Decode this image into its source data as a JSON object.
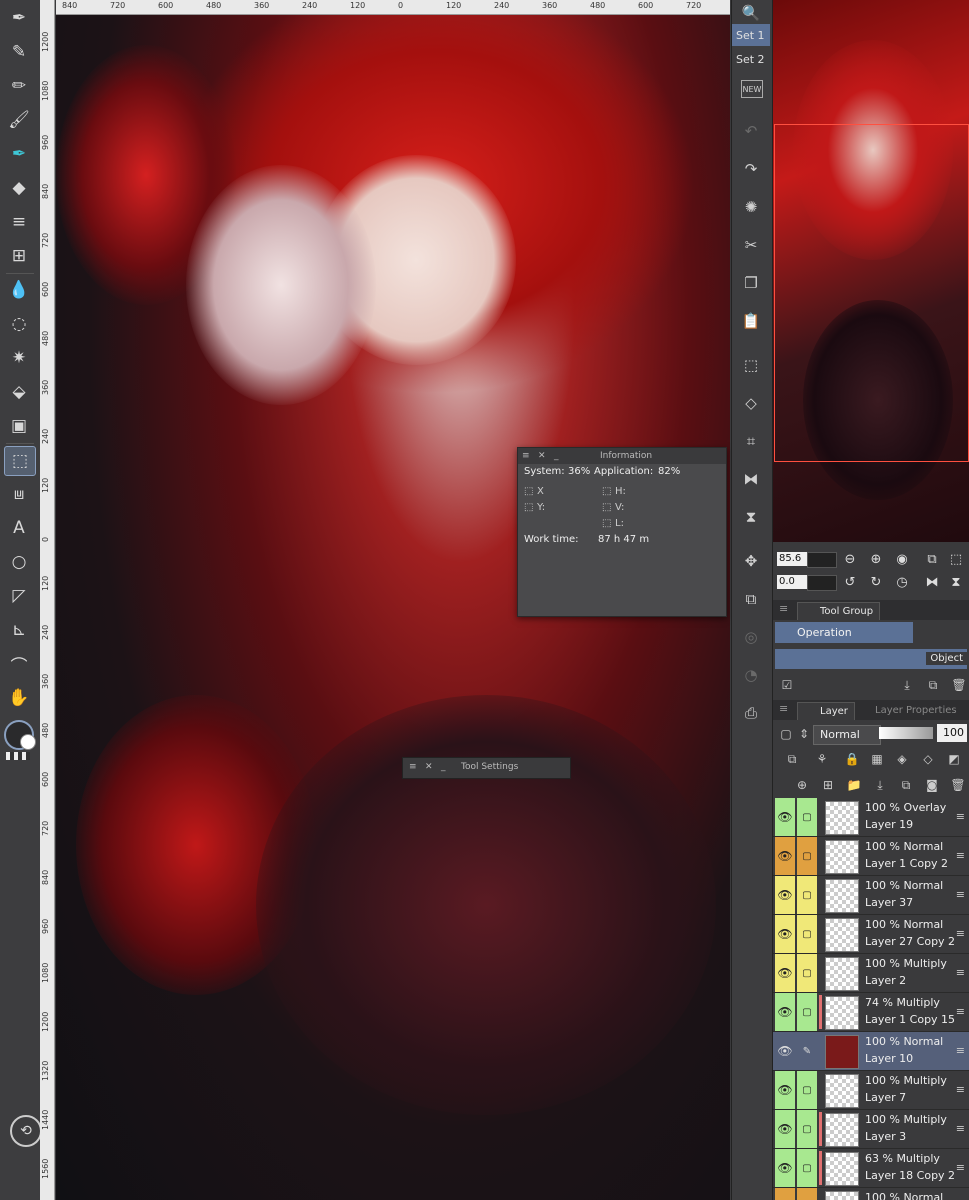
{
  "left_tools": [
    {
      "name": "fill-pen-icon",
      "glyph": "✒"
    },
    {
      "name": "pen-icon",
      "glyph": "✎"
    },
    {
      "name": "pencil-icon",
      "glyph": "✏"
    },
    {
      "name": "brush-icon",
      "glyph": "🖌"
    },
    {
      "name": "airbrush-icon",
      "glyph": "✒"
    },
    {
      "name": "eraser-icon",
      "glyph": "◆"
    },
    {
      "name": "hatching-icon",
      "glyph": "≡"
    },
    {
      "name": "grid-icon",
      "glyph": "⊞"
    },
    {
      "name": "blend-icon",
      "glyph": "💧"
    },
    {
      "name": "lasso-icon",
      "glyph": "◌"
    },
    {
      "name": "magic-wand-icon",
      "glyph": "✷"
    },
    {
      "name": "fill-icon",
      "glyph": "⬙"
    },
    {
      "name": "gradient-icon",
      "glyph": "▣"
    },
    {
      "name": "operation-icon",
      "glyph": "⬚"
    },
    {
      "name": "vector-icon",
      "glyph": "⩏"
    },
    {
      "name": "text-icon",
      "glyph": "A"
    },
    {
      "name": "balloon-icon",
      "glyph": "○"
    },
    {
      "name": "frame-icon",
      "glyph": "◸"
    },
    {
      "name": "ruler-icon",
      "glyph": "⊾"
    },
    {
      "name": "eyedropper-icon",
      "glyph": "⌒"
    },
    {
      "name": "hand-icon",
      "glyph": "✋"
    }
  ],
  "ruler_top": [
    "840",
    "720",
    "600",
    "480",
    "360",
    "240",
    "120",
    "0",
    "120",
    "240",
    "360",
    "480",
    "600",
    "720"
  ],
  "ruler_left": [
    "1200",
    "1080",
    "960",
    "840",
    "720",
    "600",
    "480",
    "360",
    "240",
    "120",
    "0",
    "120",
    "240",
    "360",
    "480",
    "600",
    "720",
    "840",
    "960",
    "1080",
    "1200",
    "1320",
    "1440",
    "1560"
  ],
  "sets": {
    "set1": "Set 1",
    "set2": "Set 2"
  },
  "mid_tools": [
    {
      "name": "new-icon",
      "glyph": "NEW",
      "dim": false
    },
    {
      "name": "undo-icon",
      "glyph": "↶",
      "dim": true
    },
    {
      "name": "redo-icon",
      "glyph": "↷",
      "dim": false
    },
    {
      "name": "loading-icon",
      "glyph": "✺",
      "dim": false
    },
    {
      "name": "cut-icon",
      "glyph": "✂",
      "dim": false
    },
    {
      "name": "copy-icon",
      "glyph": "❐",
      "dim": false
    },
    {
      "name": "paste-icon",
      "glyph": "📋",
      "dim": true
    },
    {
      "name": "transform-icon",
      "glyph": "⬚",
      "dim": false
    },
    {
      "name": "free-transform-icon",
      "glyph": "◇",
      "dim": false
    },
    {
      "name": "mesh-transform-icon",
      "glyph": "⌗",
      "dim": false
    },
    {
      "name": "flip-horizontal-icon",
      "glyph": "⧓",
      "dim": false
    },
    {
      "name": "flip-vertical-icon",
      "glyph": "⧗",
      "dim": false
    },
    {
      "name": "move-icon",
      "glyph": "✥",
      "dim": false
    },
    {
      "name": "snap-icon",
      "glyph": "⧉",
      "dim": false
    },
    {
      "name": "record-icon",
      "glyph": "◎",
      "dim": true
    },
    {
      "name": "timelapse-icon",
      "glyph": "◔",
      "dim": true
    },
    {
      "name": "export-icon",
      "glyph": "⎙",
      "dim": false
    }
  ],
  "navigator": {
    "zoom": "85.6",
    "rotate": "0.0"
  },
  "information": {
    "title": "Information",
    "system_label": "System:",
    "system_value": "36%",
    "app_label": "Application:",
    "app_value": "82%",
    "x": "X",
    "y": "Y:",
    "h": "H:",
    "v": "V:",
    "l": "L:",
    "work_label": "Work time:",
    "work_value": "87 h 47 m"
  },
  "tool_settings": {
    "title": "Tool Settings"
  },
  "tool_group": {
    "tab": "Tool Group",
    "item1": "Operation",
    "item2": "Object"
  },
  "layer_panel": {
    "tab_layer": "Layer",
    "tab_props": "Layer Properties",
    "blend_mode": "Normal",
    "opacity": "100"
  },
  "layers": [
    {
      "mode": "100 % Overlay",
      "name": "Layer 19",
      "color": "#a8e890",
      "sel": false,
      "mark": false
    },
    {
      "mode": "100 % Normal",
      "name": "Layer 1 Copy 2",
      "color": "#e0a040",
      "sel": false,
      "mark": false
    },
    {
      "mode": "100 % Normal",
      "name": "Layer 37",
      "color": "#f0e878",
      "sel": false,
      "mark": false
    },
    {
      "mode": "100 % Normal",
      "name": "Layer 27 Copy 2",
      "color": "#f0e878",
      "sel": false,
      "mark": false
    },
    {
      "mode": "100 % Multiply",
      "name": "Layer 2",
      "color": "#f0e878",
      "sel": false,
      "mark": false
    },
    {
      "mode": "74 % Multiply",
      "name": "Layer 1 Copy 15",
      "color": "#a8e890",
      "sel": false,
      "mark": true
    },
    {
      "mode": "100 % Normal",
      "name": "Layer 10",
      "color": "#55607a",
      "sel": true,
      "mark": false
    },
    {
      "mode": "100 % Multiply",
      "name": "Layer 7",
      "color": "#a8e890",
      "sel": false,
      "mark": false
    },
    {
      "mode": "100 % Multiply",
      "name": "Layer 3",
      "color": "#a8e890",
      "sel": false,
      "mark": true
    },
    {
      "mode": "63 % Multiply",
      "name": "Layer 18 Copy 2",
      "color": "#a8e890",
      "sel": false,
      "mark": true
    },
    {
      "mode": "100 % Normal",
      "name": "",
      "color": "#e0a040",
      "sel": false,
      "mark": false
    }
  ]
}
